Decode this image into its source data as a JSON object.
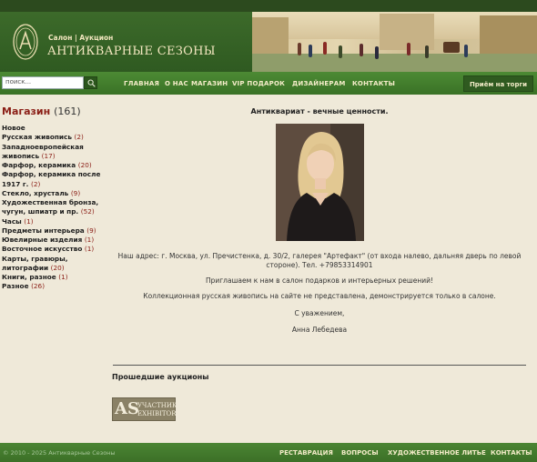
{
  "header": {
    "subtitle": "Салон | Аукцион",
    "title": "АНТИКВАРНЫЕ СЕЗОНЫ"
  },
  "search": {
    "placeholder": "поиск..."
  },
  "nav": {
    "items": [
      "ГЛАВНАЯ",
      "О НАС",
      "МАГАЗИН",
      "VIP ПОДАРОК",
      "ДИЗАЙНЕРАМ",
      "КОНТАКТЫ"
    ],
    "cta": "Приём на торги"
  },
  "sidebar": {
    "title": "Магазин",
    "count": "(161)",
    "categories": [
      {
        "label": "Новое",
        "count": ""
      },
      {
        "label": "Русская живопись",
        "count": "(2)"
      },
      {
        "label": "Западноевропейская живопись",
        "count": "(17)"
      },
      {
        "label": "Фарфор, керамика",
        "count": "(20)"
      },
      {
        "label": "Фарфор, керамика после 1917 г.",
        "count": "(2)"
      },
      {
        "label": "Стекло, хрусталь",
        "count": "(9)"
      },
      {
        "label": "Художественная бронза, чугун, шпиатр и пр.",
        "count": "(52)"
      },
      {
        "label": "Часы",
        "count": "(1)"
      },
      {
        "label": "Предметы интерьера",
        "count": "(9)"
      },
      {
        "label": "Ювелирные изделия",
        "count": "(1)"
      },
      {
        "label": "Восточное искусство",
        "count": "(1)"
      },
      {
        "label": "Карты, гравюры, литографии",
        "count": "(20)"
      },
      {
        "label": "Книги, разное",
        "count": "(1)"
      },
      {
        "label": "Разное",
        "count": "(26)"
      }
    ]
  },
  "main": {
    "heading": "Антиквариат - вечные ценности.",
    "address": "Наш адрес: г. Москва, ул. Пречистенка, д. 30/2, галерея \"Артефакт\" (от входа налево, дальняя дверь по левой стороне). Тел. +79853314901",
    "invite": "Приглашаем к нам в салон подарков и интерьерных решений!",
    "note": "Коллекционная русская живопись на сайте не представлена, демонстрируется только в салоне.",
    "regards": "С уважением,",
    "signature": "Анна Лебедева",
    "past_auctions": "Прошедшие аукционы",
    "badge": {
      "mark": "AS",
      "line1": "УЧАСТНИК",
      "line2": "EXHIBITOR"
    }
  },
  "footer": {
    "copyright": "© 2010 - 2025 Антикварные Сезоны",
    "links": [
      "РЕСТАВРАЦИЯ",
      "ВОПРОСЫ",
      "ХУДОЖЕСТВЕННОЕ ЛИТЬЕ",
      "КОНТАКТЫ"
    ]
  },
  "colors": {
    "brand_green": "#3c6a2a",
    "accent_red": "#8a1d15",
    "cream": "#f4ecc9"
  }
}
